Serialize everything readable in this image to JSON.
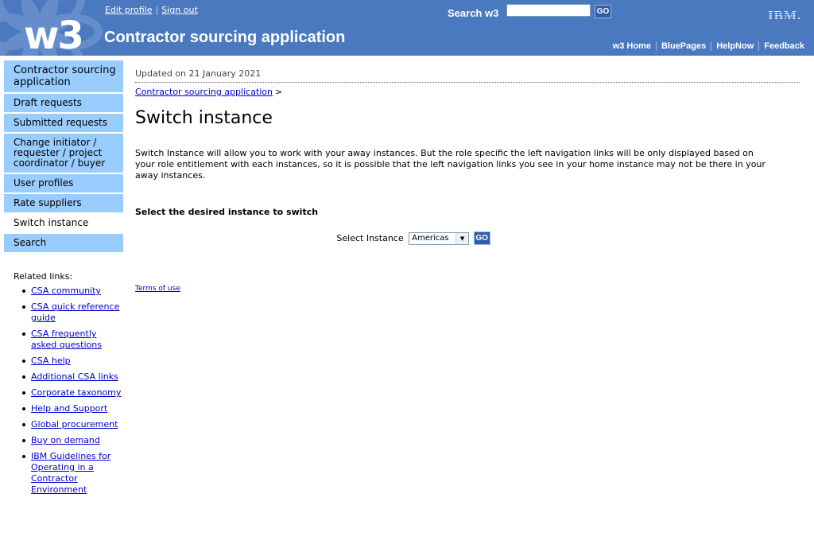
{
  "masthead": {
    "logo": "w3",
    "title": "Contractor sourcing application",
    "top_links": {
      "edit_profile": "Edit profile",
      "separator": "|",
      "sign_out": "Sign out"
    },
    "search": {
      "label": "Search w3",
      "value": "",
      "button": "GO"
    },
    "brand": "IBM.",
    "nav": [
      "w3 Home",
      "BluePages",
      "HelpNow",
      "Feedback"
    ],
    "colors": {
      "background": "#4a79bf"
    }
  },
  "left_nav": {
    "items": [
      {
        "label": "Contractor sourcing application",
        "active": false
      },
      {
        "label": "Draft requests",
        "active": false
      },
      {
        "label": "Submitted requests",
        "active": false
      },
      {
        "label": "Change initiator / requester / project coordinator / buyer",
        "active": false
      },
      {
        "label": "User profiles",
        "active": false
      },
      {
        "label": "Rate suppliers",
        "active": false
      },
      {
        "label": "Switch instance",
        "active": true
      },
      {
        "label": "Search",
        "active": false
      }
    ],
    "colors": {
      "item_bg": "#99ccff"
    }
  },
  "related": {
    "heading": "Related links:",
    "links": [
      "CSA community",
      "CSA quick reference guide",
      "CSA frequently asked questions",
      "CSA help",
      "Additional CSA links",
      "Corporate taxonomy",
      "Help and Support",
      "Global procurement",
      "Buy on demand",
      "IBM Guidelines for Operating in a Contractor Environment"
    ]
  },
  "content": {
    "updated": "Updated on 21 January 2021",
    "breadcrumb": {
      "link": "Contractor sourcing application",
      "arrow": ">"
    },
    "title": "Switch instance",
    "intro": "Switch Instance will allow you to work with your away instances. But the role specific the left navigation links will be only displayed based on your role entitlement with each instances, so it is possible that the left navigation links you see in your home instance may not be there in your away instances.",
    "select_heading": "Select the desired instance to switch",
    "select_label": "Select Instance",
    "select_value": "Americas",
    "go_button": "GO",
    "terms": "Terms of use"
  }
}
